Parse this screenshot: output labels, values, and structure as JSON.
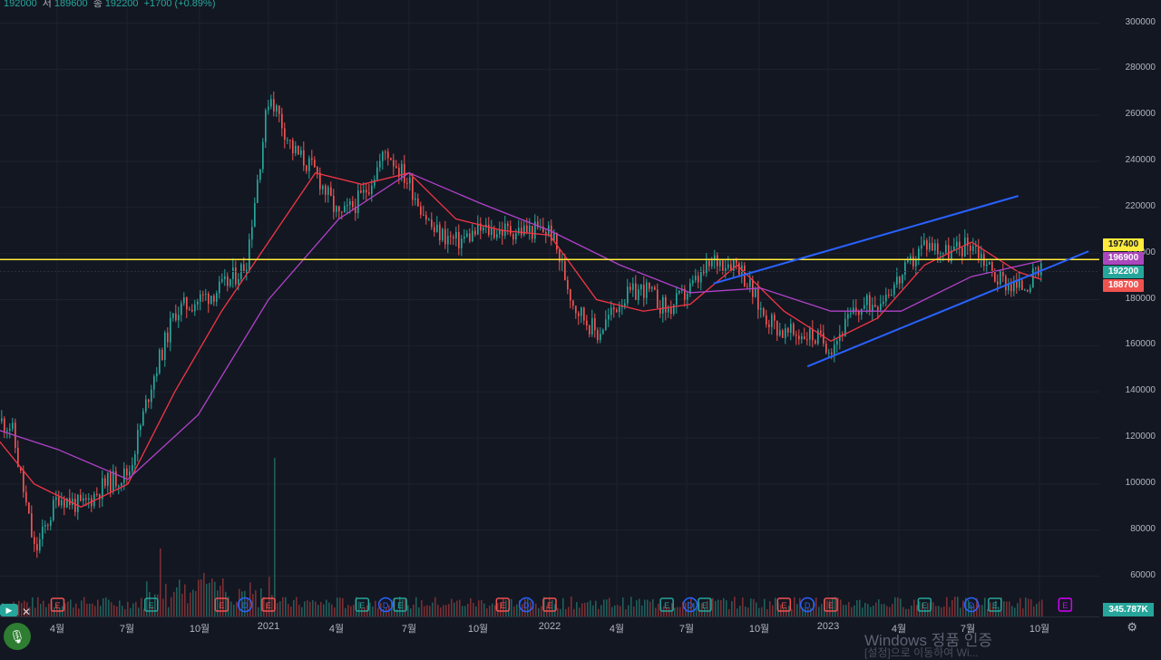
{
  "legend": {
    "open": "192000",
    "low_label": "저",
    "low": "189600",
    "close_label": "종",
    "close": "192200",
    "change": "+1700 (+0.89%)"
  },
  "price_tags": [
    {
      "value": "197400",
      "bg": "#ffeb3b",
      "fg": "#131722"
    },
    {
      "value": "196900",
      "bg": "#ab47bc",
      "fg": "#ffffff"
    },
    {
      "value": "192200",
      "bg": "#26a69a",
      "fg": "#ffffff"
    },
    {
      "value": "188700",
      "bg": "#ef5350",
      "fg": "#ffffff"
    }
  ],
  "volume_tag": "345.787K",
  "watermark": "Windows 정품 인증",
  "watermark_sub": "[설정]으로 이동하여 Wi...",
  "colors": {
    "background": "#131722",
    "up": "#26a69a",
    "down": "#ef5350",
    "ma_fast": "#f23645",
    "ma_slow": "#b042c8",
    "hline": "#ffeb3b",
    "channel": "#2962ff"
  },
  "chart_data": {
    "type": "line",
    "title": "",
    "xlabel": "",
    "ylabel": "",
    "ylim": [
      47000,
      305000
    ],
    "y_ticks": [
      60000,
      80000,
      100000,
      120000,
      140000,
      160000,
      180000,
      200000,
      220000,
      240000,
      260000,
      280000,
      300000
    ],
    "x_ticks": [
      "4월",
      "7월",
      "10월",
      "2021",
      "4월",
      "7월",
      "10월",
      "2022",
      "4월",
      "7월",
      "10월",
      "2023",
      "4월",
      "7월",
      "10월"
    ],
    "grid": true,
    "series": [
      {
        "kind": "price",
        "x": [
          "2020-01",
          "2020-02",
          "2020-03",
          "2020-04",
          "2020-05",
          "2020-06",
          "2020-07",
          "2020-08",
          "2020-09",
          "2020-10",
          "2020-11",
          "2020-12",
          "2021-01",
          "2021-02",
          "2021-03",
          "2021-04",
          "2021-05",
          "2021-06",
          "2021-07",
          "2021-08",
          "2021-09",
          "2021-10",
          "2021-11",
          "2021-12",
          "2022-01",
          "2022-02",
          "2022-03",
          "2022-04",
          "2022-05",
          "2022-06",
          "2022-07",
          "2022-08",
          "2022-09",
          "2022-10",
          "2022-11",
          "2022-12",
          "2023-01",
          "2023-02",
          "2023-03",
          "2023-04",
          "2023-05",
          "2023-06",
          "2023-07",
          "2023-08",
          "2023-09",
          "2023-10"
        ],
        "values": [
          130000,
          125000,
          70000,
          95000,
          90000,
          100000,
          105000,
          145000,
          175000,
          180000,
          185000,
          195000,
          270000,
          245000,
          235000,
          215000,
          225000,
          245000,
          230000,
          210000,
          205000,
          210000,
          210000,
          210000,
          210000,
          178000,
          165000,
          180000,
          185000,
          175000,
          185000,
          197000,
          196000,
          175000,
          165000,
          165000,
          160000,
          175000,
          180000,
          190000,
          205000,
          200000,
          205000,
          190000,
          185000,
          192200
        ]
      },
      {
        "kind": "ma_fast",
        "x": [
          "2020-01",
          "2020-03",
          "2020-05",
          "2020-07",
          "2020-09",
          "2020-11",
          "2021-01",
          "2021-03",
          "2021-05",
          "2021-07",
          "2021-09",
          "2021-11",
          "2022-01",
          "2022-03",
          "2022-05",
          "2022-07",
          "2022-09",
          "2022-11",
          "2023-01",
          "2023-03",
          "2023-05",
          "2023-07",
          "2023-09",
          "2023-10"
        ],
        "values": [
          125000,
          100000,
          90000,
          100000,
          140000,
          175000,
          205000,
          235000,
          230000,
          235000,
          215000,
          210000,
          208000,
          180000,
          175000,
          178000,
          195000,
          175000,
          162000,
          172000,
          195000,
          205000,
          192000,
          188700
        ]
      },
      {
        "kind": "ma_slow",
        "x": [
          "2020-01",
          "2020-04",
          "2020-07",
          "2020-10",
          "2021-01",
          "2021-04",
          "2021-07",
          "2021-10",
          "2022-01",
          "2022-04",
          "2022-07",
          "2022-10",
          "2023-01",
          "2023-04",
          "2023-07",
          "2023-10"
        ],
        "values": [
          125000,
          115000,
          102000,
          130000,
          180000,
          215000,
          235000,
          222000,
          210000,
          195000,
          183000,
          185000,
          175000,
          175000,
          190000,
          196900
        ]
      }
    ],
    "hline": 197400,
    "channel": {
      "upper": [
        [
          "2022-08",
          187000
        ],
        [
          "2023-09",
          225000
        ]
      ],
      "lower": [
        [
          "2022-12",
          151000
        ],
        [
          "2023-12",
          201000
        ]
      ]
    },
    "events": [
      {
        "x": "2020-04",
        "label": "E",
        "kind": "red"
      },
      {
        "x": "2020-08",
        "label": "E",
        "kind": "green"
      },
      {
        "x": "2020-11",
        "label": "E",
        "kind": "red"
      },
      {
        "x": "2020-12",
        "label": "D",
        "kind": "blue"
      },
      {
        "x": "2021-01",
        "label": "E",
        "kind": "red"
      },
      {
        "x": "2021-05",
        "label": "E",
        "kind": "green"
      },
      {
        "x": "2021-06",
        "label": "D",
        "kind": "blue"
      },
      {
        "x": "2021-06",
        "label": "E",
        "kind": "green"
      },
      {
        "x": "2021-11",
        "label": "E",
        "kind": "red"
      },
      {
        "x": "2021-12",
        "label": "D",
        "kind": "blue"
      },
      {
        "x": "2022-01",
        "label": "E",
        "kind": "red"
      },
      {
        "x": "2022-06",
        "label": "E",
        "kind": "green"
      },
      {
        "x": "2022-07",
        "label": "D",
        "kind": "blue"
      },
      {
        "x": "2022-07",
        "label": "E",
        "kind": "green"
      },
      {
        "x": "2022-11",
        "label": "E",
        "kind": "red"
      },
      {
        "x": "2022-12",
        "label": "D",
        "kind": "blue"
      },
      {
        "x": "2023-01",
        "label": "E",
        "kind": "red"
      },
      {
        "x": "2023-05",
        "label": "E",
        "kind": "green"
      },
      {
        "x": "2023-07",
        "label": "D",
        "kind": "blue"
      },
      {
        "x": "2023-08",
        "label": "E",
        "kind": "green"
      },
      {
        "x": "2023-11",
        "label": "E",
        "kind": "purple"
      }
    ]
  }
}
